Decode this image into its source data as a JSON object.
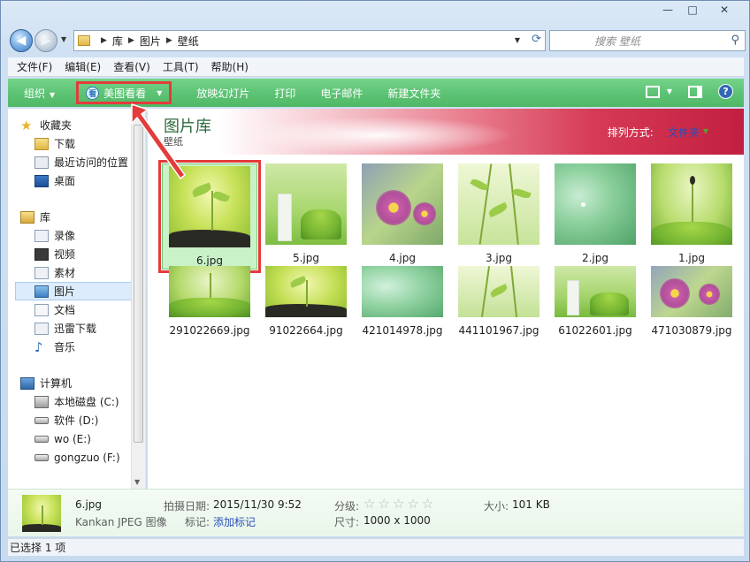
{
  "window": {
    "caption_minimize": "—",
    "caption_maximize": "□",
    "caption_close": "✕"
  },
  "address": {
    "crumbs": [
      "库",
      "图片",
      "壁纸"
    ],
    "search_placeholder": "搜索 壁纸"
  },
  "menu": {
    "items": [
      "文件(F)",
      "编辑(E)",
      "查看(V)",
      "工具(T)",
      "帮助(H)"
    ]
  },
  "toolbar": {
    "organize": "组织",
    "open_with": "美图看看",
    "open_with_icon_text": "看",
    "slideshow": "放映幻灯片",
    "print": "打印",
    "email": "电子邮件",
    "new_folder": "新建文件夹",
    "help": "?"
  },
  "nav": {
    "favorites_header": "收藏夹",
    "favorites": [
      "下载",
      "最近访问的位置",
      "桌面"
    ],
    "libraries_header": "库",
    "libraries": [
      "录像",
      "视频",
      "素材",
      "图片",
      "文档",
      "迅雷下载",
      "音乐"
    ],
    "computer_header": "计算机",
    "drives": [
      "本地磁盘 (C:)",
      "软件 (D:)",
      "wo (E:)",
      "gongzuo (F:)"
    ],
    "selected": "图片"
  },
  "content": {
    "library_title": "图片库",
    "library_subtitle": "壁纸",
    "arrange_label": "排列方式:",
    "arrange_value": "文件夹"
  },
  "files": [
    {
      "name": "6.jpg"
    },
    {
      "name": "5.jpg"
    },
    {
      "name": "4.jpg"
    },
    {
      "name": "3.jpg"
    },
    {
      "name": "2.jpg"
    },
    {
      "name": "1.jpg"
    },
    {
      "name": "291022669.jpg"
    },
    {
      "name": "91022664.jpg"
    },
    {
      "name": "421014978.jpg"
    },
    {
      "name": "441101967.jpg"
    },
    {
      "name": "61022601.jpg"
    },
    {
      "name": "471030879.jpg"
    }
  ],
  "details": {
    "name": "6.jpg",
    "type": "Kankan JPEG 图像",
    "date_label": "拍摄日期:",
    "date_value": "2015/11/30 9:52",
    "tags_label": "标记:",
    "tags_value": "添加标记",
    "rating_label": "分级:",
    "stars": "☆☆☆☆☆",
    "size_label": "大小:",
    "size_value": "101 KB",
    "dims_label": "尺寸:",
    "dims_value": "1000 x 1000"
  },
  "status": {
    "text": "已选择 1 项"
  },
  "colors": {
    "accent_green": "#5ec476",
    "highlight_red": "#e43b3b",
    "banner_red": "#c21f40"
  }
}
